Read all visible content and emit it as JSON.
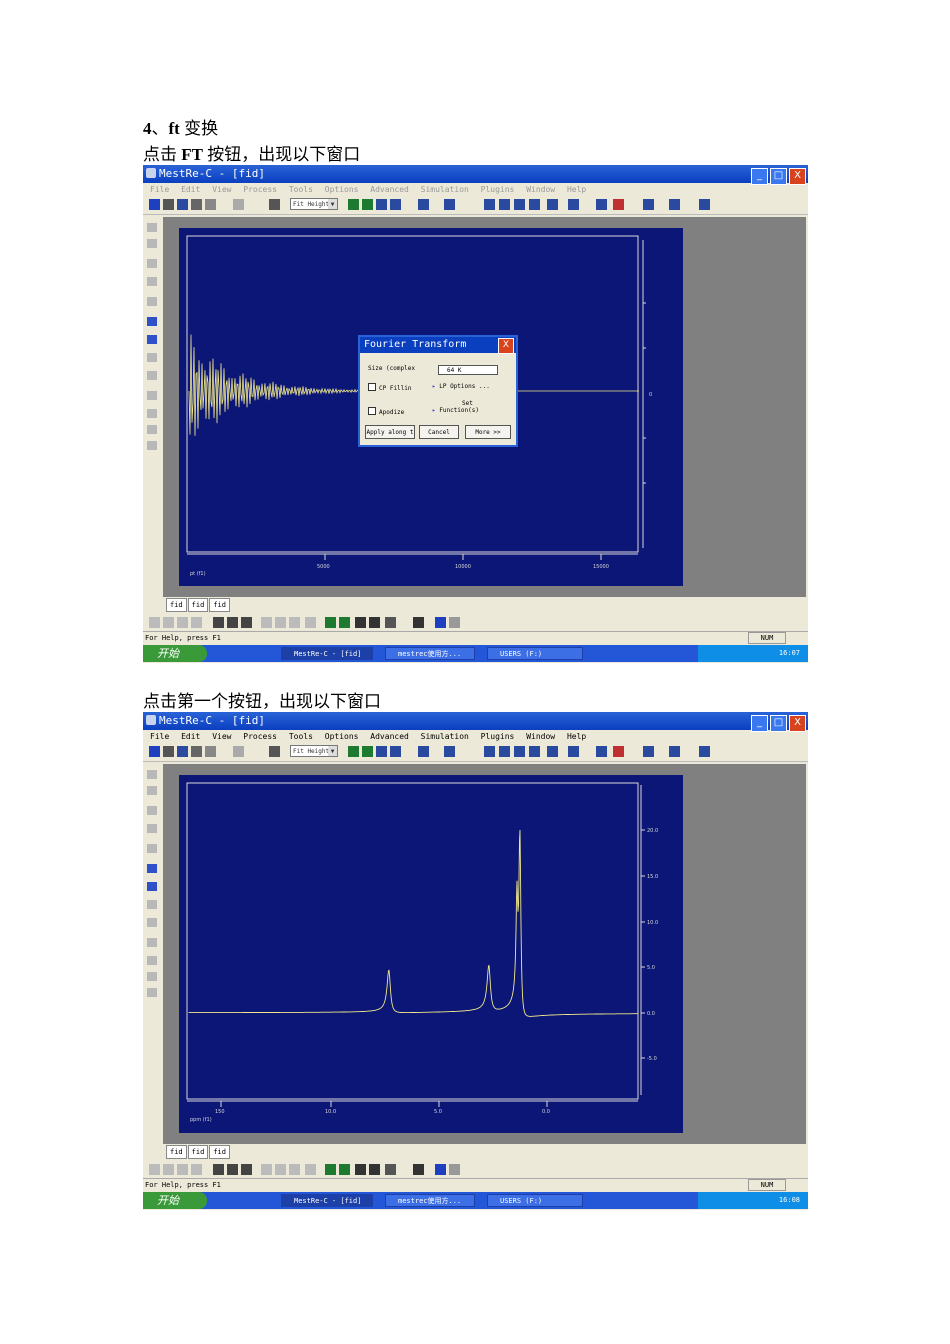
{
  "doc": {
    "heading_num": "4",
    "heading_sep": "、",
    "heading_ft": "ft",
    "heading_rest": " 变换",
    "para1_pre": "点击 ",
    "para1_bold": "FT",
    "para1_post": " 按钮，出现以下窗口",
    "para2": "点击第一个按钮，出现以下窗口"
  },
  "app": {
    "title": "MestRe-C - [fid]",
    "menu": [
      "File",
      "Edit",
      "View",
      "Process",
      "Tools",
      "Options",
      "Advanced",
      "Simulation",
      "Plugins",
      "Window",
      "Help"
    ],
    "zoom_select": "Fit Height",
    "tabs": [
      "fid",
      "fid",
      "fid"
    ],
    "status_text": "For Help, press F1",
    "status_num": "NUM",
    "start_label": "开始",
    "task1": "MestRe-C - [fid]",
    "task2": "mestrec使用方...",
    "task3": "USERS (F:)",
    "clock1": "16:07",
    "clock2": "16:08",
    "win_min": "_",
    "win_max": "□",
    "win_close": "X"
  },
  "dialog": {
    "title": "Fourier Transform",
    "size_label": "Size (complex",
    "size_value": "64 K",
    "cp_label": "CP Fillin",
    "lp_label": "LP Options ...",
    "apodize_label": "Apodize",
    "set_label": "Set",
    "function_label": "Function(s)",
    "apply_label": "Apply along t",
    "cancel_label": "Cancel",
    "more_label": "More >>",
    "close": "X"
  },
  "plot1": {
    "xlabel": "pt (f1)",
    "ticks": [
      "5000",
      "10000",
      "15000"
    ],
    "y_tick": "0"
  },
  "plot2": {
    "xlabel": "ppm (f1)",
    "x_ticks": [
      "150",
      "10.0",
      "5.0",
      "0.0"
    ],
    "y_ticks": [
      "20.0",
      "15.0",
      "10.0",
      "5.0",
      "0.0",
      "-5.0"
    ]
  },
  "colors": {
    "plot_bg": "#0b1677",
    "trace": "#f2e98a",
    "titlebar": "#0a3fbf"
  }
}
